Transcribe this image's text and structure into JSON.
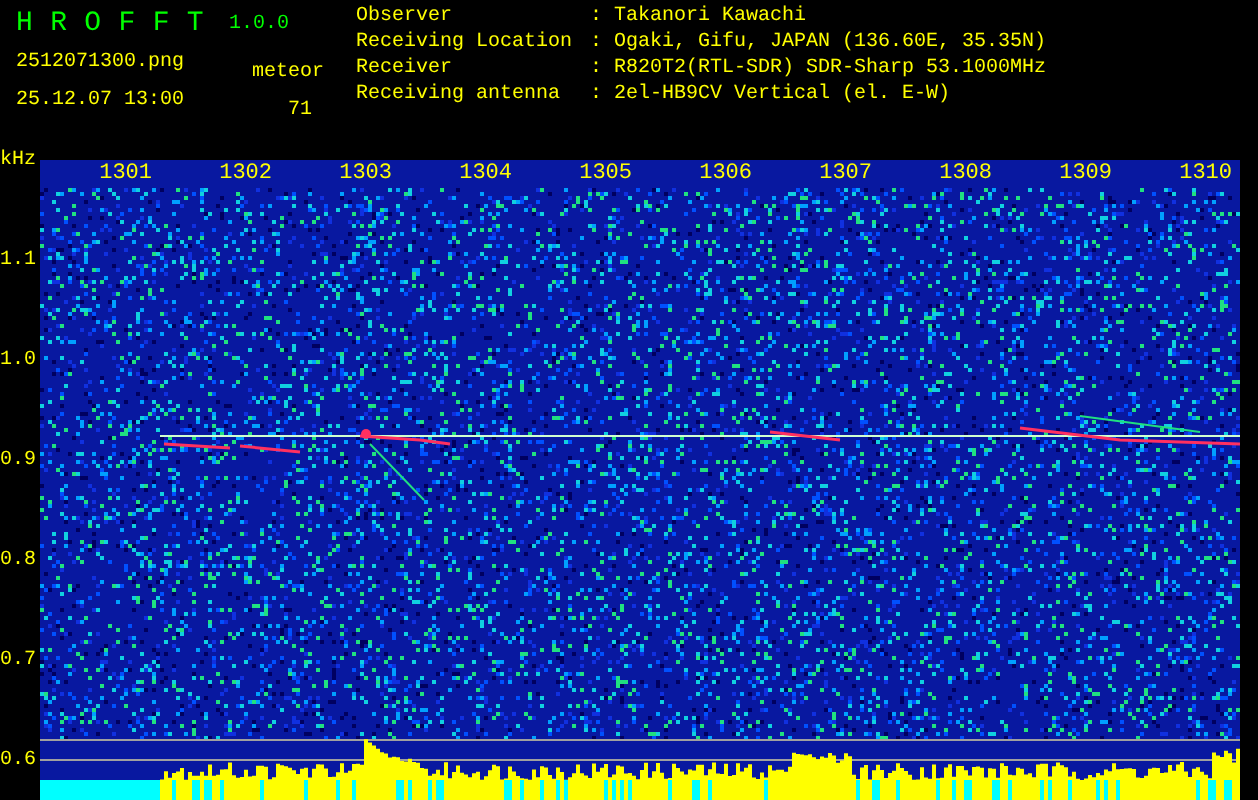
{
  "app": {
    "name": "HROFFT",
    "version": "1.0.0"
  },
  "file": {
    "filename": "2512071300.png",
    "datetime": "25.12.07 13:00"
  },
  "count": {
    "label": "meteor",
    "value": "71"
  },
  "info": [
    {
      "label": "Observer",
      "separator": ":",
      "value": "Takanori Kawachi"
    },
    {
      "label": "Receiving Location",
      "separator": ":",
      "value": "Ogaki, Gifu, JAPAN (136.60E, 35.35N)"
    },
    {
      "label": "Receiver",
      "separator": ":",
      "value": "R820T2(RTL-SDR) SDR-Sharp 53.1000MHz"
    },
    {
      "label": "Receiving antenna",
      "separator": ":",
      "value": "2el-HB9CV Vertical (el. E-W)"
    }
  ],
  "spectrogram": {
    "y_unit": "kHz",
    "y_labels": [
      "1.1",
      "1.0",
      "0.9",
      "0.8",
      "0.7",
      "0.6"
    ],
    "x_labels": [
      "1301",
      "1302",
      "1303",
      "1304",
      "1305",
      "1306",
      "1307",
      "1308",
      "1309",
      "1310"
    ]
  }
}
